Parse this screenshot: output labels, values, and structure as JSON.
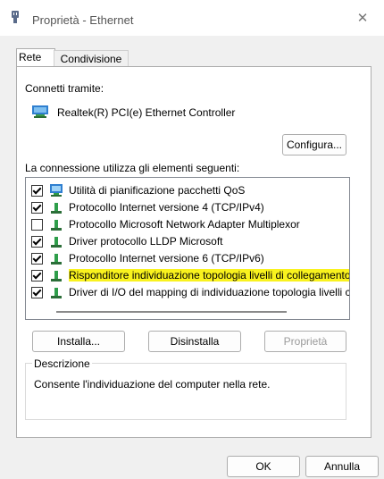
{
  "window": {
    "title": "Proprietà - Ethernet",
    "close_label": "✕"
  },
  "tabs": [
    {
      "label": "Rete"
    },
    {
      "label": "Condivisione"
    }
  ],
  "connect_using_label": "Connetti tramite:",
  "adapter_name": "Realtek(R) PCI(e) Ethernet Controller",
  "configure_button": "Configura...",
  "items_label": "La connessione utilizza gli elementi seguenti:",
  "components": [
    {
      "label": "Utilità di pianificazione pacchetti QoS",
      "checked": true,
      "icon": "qos-scheduler-icon"
    },
    {
      "label": "Protocollo Internet versione 4 (TCP/IPv4)",
      "checked": true,
      "icon": "protocol-icon"
    },
    {
      "label": "Protocollo Microsoft Network Adapter Multiplexor",
      "checked": false,
      "icon": "protocol-icon"
    },
    {
      "label": "Driver protocollo LLDP Microsoft",
      "checked": true,
      "icon": "protocol-icon"
    },
    {
      "label": "Protocollo Internet versione 6 (TCP/IPv6)",
      "checked": true,
      "icon": "protocol-icon"
    },
    {
      "label": "Risponditore individuazione topologia livelli di collegamento",
      "checked": true,
      "icon": "protocol-icon",
      "highlighted": true
    },
    {
      "label": "Driver di I/O del mapping di individuazione topologia livelli c",
      "checked": true,
      "icon": "protocol-icon"
    }
  ],
  "buttons": {
    "install": "Installa...",
    "uninstall": "Disinstalla",
    "properties": "Proprietà"
  },
  "description": {
    "title": "Descrizione",
    "text": "Consente l'individuazione del computer nella rete."
  },
  "footer": {
    "ok": "OK",
    "cancel": "Annulla"
  },
  "colors": {
    "highlight": "#f9f21e",
    "icon_green": "#2e9e4a",
    "icon_blue": "#2f7fd0"
  }
}
